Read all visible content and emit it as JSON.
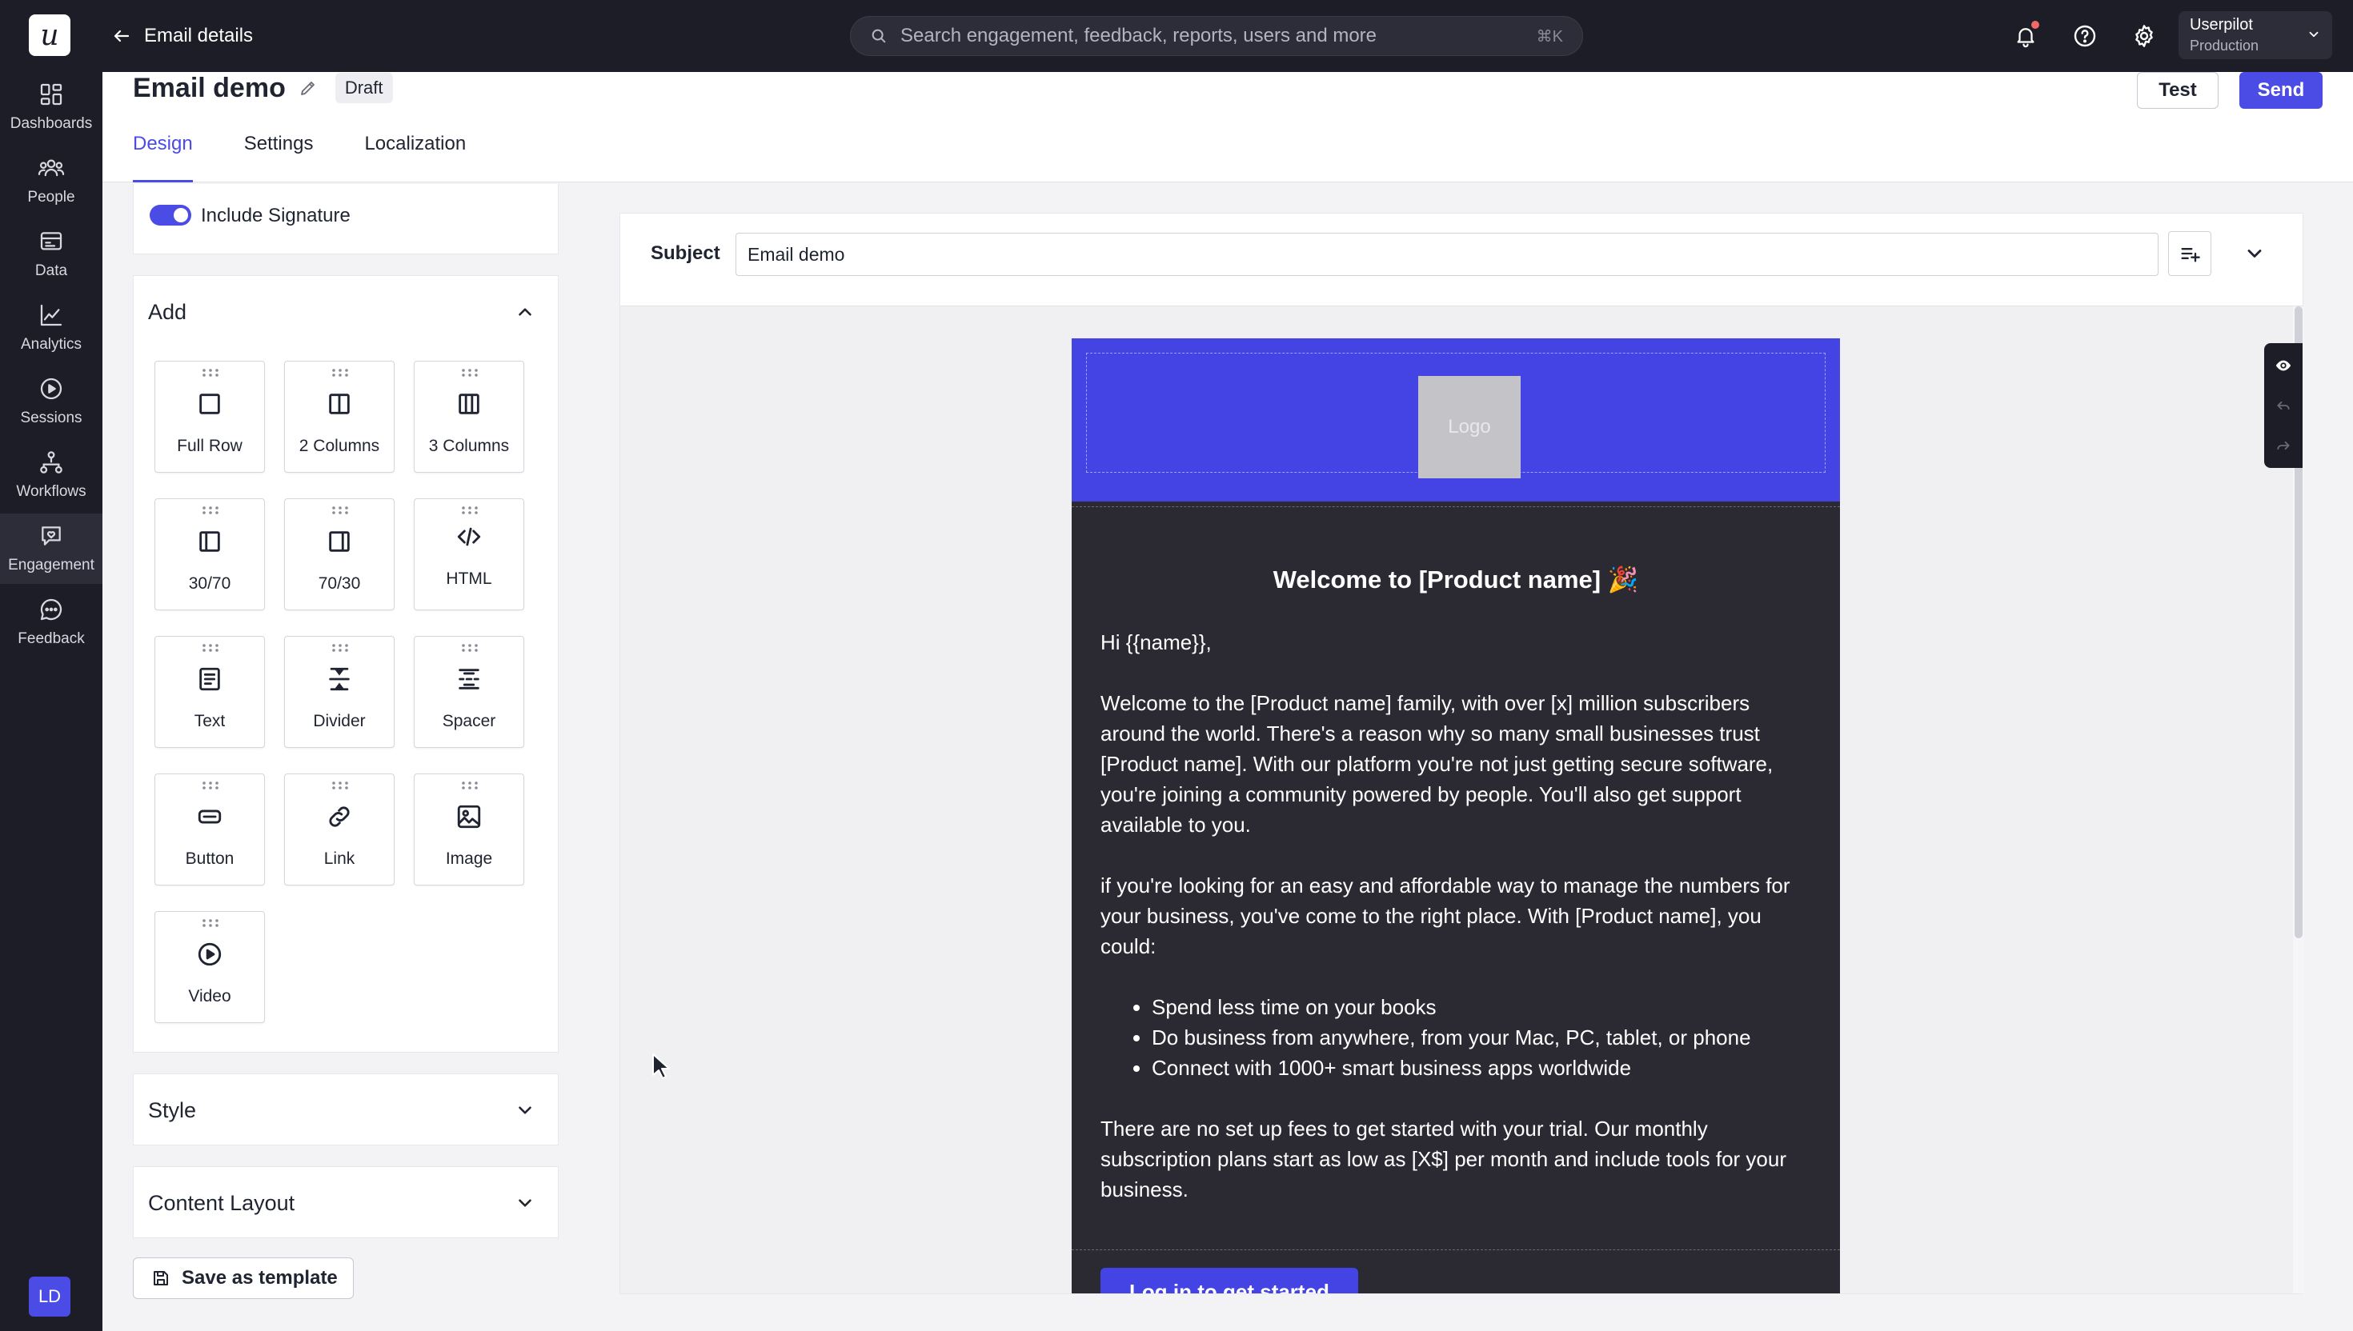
{
  "topbar": {
    "logo_letter": "u",
    "back_label": "Email details",
    "search_placeholder": "Search engagement, feedback, reports, users and more",
    "search_shortcut": "⌘K",
    "account_name": "Userpilot",
    "account_env": "Production"
  },
  "nav": {
    "items": [
      {
        "label": "Dashboards",
        "icon": "dashboard-icon"
      },
      {
        "label": "People",
        "icon": "people-icon"
      },
      {
        "label": "Data",
        "icon": "data-icon"
      },
      {
        "label": "Analytics",
        "icon": "analytics-icon"
      },
      {
        "label": "Sessions",
        "icon": "play-circle-icon"
      },
      {
        "label": "Workflows",
        "icon": "workflow-icon"
      },
      {
        "label": "Engagement",
        "icon": "engagement-icon"
      },
      {
        "label": "Feedback",
        "icon": "chat-icon"
      }
    ],
    "active": "Engagement",
    "avatar_initials": "LD"
  },
  "header": {
    "title": "Email demo",
    "status": "Draft",
    "tabs": [
      "Design",
      "Settings",
      "Localization"
    ],
    "active_tab": "Design",
    "test_label": "Test",
    "send_label": "Send"
  },
  "sidebar": {
    "signature_label": "Include Signature",
    "signature_on": true,
    "add_title": "Add",
    "blocks": [
      {
        "label": "Full Row",
        "icon": "full-row-icon"
      },
      {
        "label": "2 Columns",
        "icon": "two-columns-icon"
      },
      {
        "label": "3 Columns",
        "icon": "three-columns-icon"
      },
      {
        "label": "30/70",
        "icon": "layout-30-70-icon"
      },
      {
        "label": "70/30",
        "icon": "layout-70-30-icon"
      },
      {
        "label": "HTML",
        "icon": "code-icon"
      },
      {
        "label": "Text",
        "icon": "text-icon"
      },
      {
        "label": "Divider",
        "icon": "divider-icon"
      },
      {
        "label": "Spacer",
        "icon": "spacer-icon"
      },
      {
        "label": "Button",
        "icon": "button-icon"
      },
      {
        "label": "Link",
        "icon": "link-icon"
      },
      {
        "label": "Image",
        "icon": "image-icon"
      },
      {
        "label": "Video",
        "icon": "video-icon"
      }
    ],
    "style_title": "Style",
    "content_layout_title": "Content Layout",
    "save_template_label": "Save as template"
  },
  "editor": {
    "subject_label": "Subject",
    "subject_value": "Email demo"
  },
  "email": {
    "logo_text": "Logo",
    "heading": "Welcome to [Product name] 🎉",
    "greeting": "Hi {{name}},",
    "paragraph1": "Welcome to the [Product name] family, with over [x] million subscribers around the world. There's a reason why so many small businesses trust [Product name]. With our platform you're not just getting secure software, you're joining a community powered by people. You'll also get support available to you.",
    "paragraph2": "if you're looking for an easy and affordable way to manage the numbers for your business, you've come to the right place. With [Product name], you could:",
    "bullets": [
      "Spend less time on your books",
      "Do business from anywhere, from your Mac, PC, tablet, or phone",
      "Connect with 1000+ smart business apps worldwide"
    ],
    "paragraph3": "There are no set up fees to get started with your trial. Our monthly subscription plans start as low as [X$] per month and include tools for your business.",
    "cta_label": "Log in to get started"
  },
  "colors": {
    "brand": "#4b4be6",
    "topbar": "#1d1d27",
    "email_bg": "#2b2a33",
    "email_header": "#4444e5"
  }
}
